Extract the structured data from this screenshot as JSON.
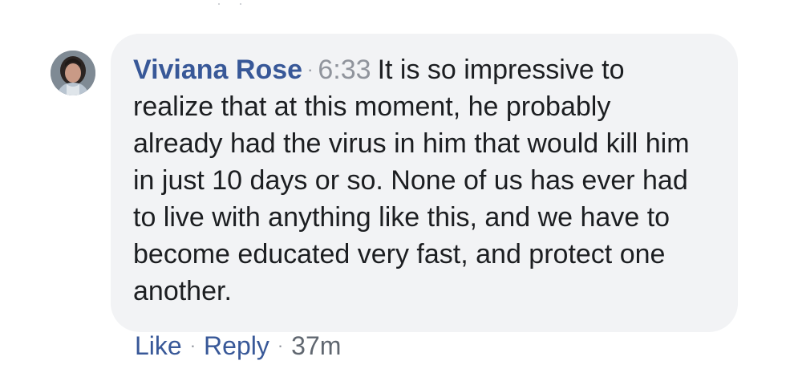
{
  "comment": {
    "author": "Viviana Rose",
    "separator": "·",
    "time": "6:33",
    "text": "It is so impressive to realize that at this moment, he probably already had the virus in him that would kill him in just 10 days or so. None of us has ever had to live with anything like this, and we have to become educated very fast, and protect one another."
  },
  "actions": {
    "like_label": "Like",
    "dot": "·",
    "reply_label": "Reply",
    "age": "37m"
  },
  "avatar": {
    "icon": "user-avatar-icon"
  },
  "colors": {
    "bubble_bg": "#f2f3f5",
    "author_link": "#385898",
    "meta_gray": "#90949c",
    "text": "#1c1e21"
  }
}
